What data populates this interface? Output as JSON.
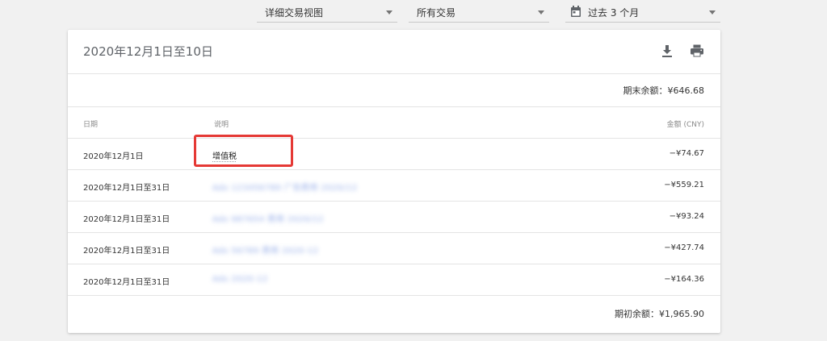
{
  "filters": {
    "view": "详细交易视图",
    "transaction_type": "所有交易",
    "date_range": "过去 3 个月"
  },
  "card": {
    "title": "2020年12月1日至10日",
    "ending_balance": "期末余额：¥646.68",
    "opening_balance": "期初余额：¥1,965.90"
  },
  "table": {
    "headers": {
      "date": "日期",
      "description": "说明",
      "amount": "金额 (CNY)"
    },
    "rows": [
      {
        "date": "2020年12月1日",
        "description": "增值税",
        "amount": "−¥74.67"
      },
      {
        "date": "2020年12月1日至31日",
        "description": "Ads 123456789 广告费用 2020/12",
        "amount": "−¥559.21"
      },
      {
        "date": "2020年12月1日至31日",
        "description": "Ads 987654 费用 2020/12",
        "amount": "−¥93.24"
      },
      {
        "date": "2020年12月1日至31日",
        "description": "Ads 56789 费用 2020-12",
        "amount": "−¥427.74"
      },
      {
        "date": "2020年12月1日至31日",
        "description": "Ads 2020-12",
        "amount": "−¥164.36"
      }
    ]
  },
  "icons": {
    "calendar": "calendar-icon",
    "download": "download-icon",
    "print": "print-icon"
  },
  "colors": {
    "highlight": "#e53935",
    "blurred_text": "#6f8fe0",
    "icon": "#5f6368"
  }
}
